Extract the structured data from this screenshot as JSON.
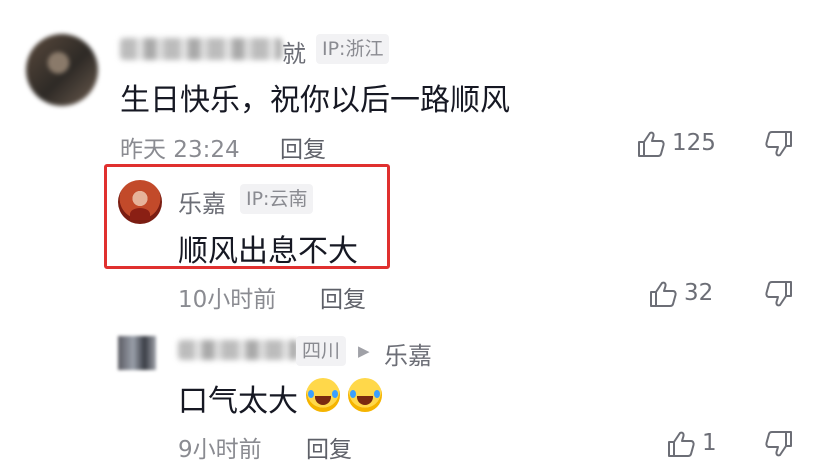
{
  "comments": [
    {
      "username_visible": "就",
      "ip_label": "IP:浙江",
      "text": "生日快乐，祝你以后一路顺风",
      "time": "昨天 23:24",
      "reply_label": "回复",
      "likes": "125"
    },
    {
      "username": "乐嘉",
      "ip_label": "IP:云南",
      "text": "顺风出息不大",
      "time": "10小时前",
      "reply_label": "回复",
      "likes": "32"
    },
    {
      "ip_label": "四川",
      "reply_to_arrow": "▶",
      "reply_to": "乐嘉",
      "text": "口气太大",
      "emojis": [
        "laugh-cry-emoji",
        "laugh-cry-emoji"
      ],
      "time": "9小时前",
      "reply_label": "回复",
      "likes": "1"
    }
  ],
  "colors": {
    "highlight_border": "#e0302f",
    "meta_gray": "#8a8b91",
    "text_dark": "#161823"
  }
}
